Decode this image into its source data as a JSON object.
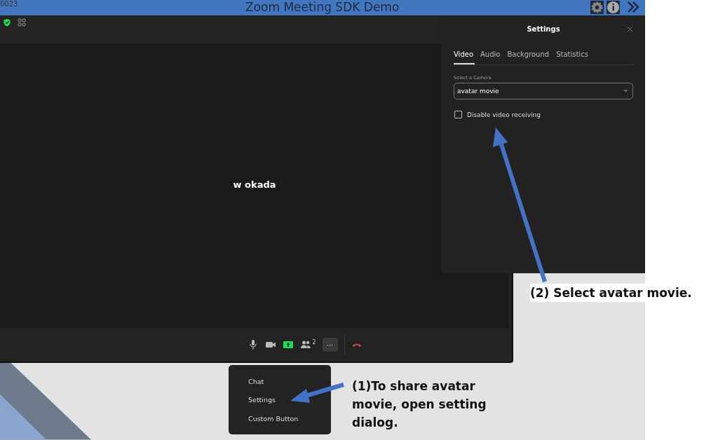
{
  "app_bar": {
    "meeting_id": "0023",
    "title": "Zoom Meeting SDK Demo"
  },
  "meeting": {
    "participant_name": "w okada",
    "participants_count": "2",
    "more_label": "···"
  },
  "settings": {
    "title": "Settings",
    "tabs": [
      {
        "label": "Video",
        "selected": true
      },
      {
        "label": "Audio",
        "selected": false
      },
      {
        "label": "Background",
        "selected": false
      },
      {
        "label": "Statistics",
        "selected": false
      }
    ],
    "camera_label": "Select a Camera",
    "camera_value": "avatar movie",
    "options": [
      {
        "label": "Disable video receiving",
        "checked": false
      }
    ]
  },
  "more_menu": {
    "items": [
      "Chat",
      "Settings",
      "Custom Button"
    ]
  },
  "annotations": [
    {
      "kind": "menu",
      "text": "(1)To share avatar movie, open setting dialog."
    },
    {
      "kind": "camera",
      "text": "(2) Select avatar movie."
    }
  ]
}
